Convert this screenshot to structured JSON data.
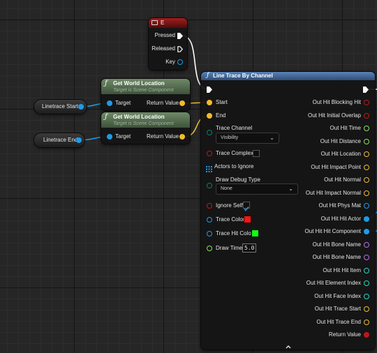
{
  "colors": {
    "exec": "#ffffff",
    "vector": "#f2bb2d",
    "object": "#1f9be6",
    "byte": "#0f7c6a",
    "bool": "#c01616",
    "array": "#1f9be6",
    "linear_color": "#1f9be6",
    "float": "#86e35a",
    "struct": "#1f9be6",
    "name": "#b76cf2",
    "int": "#21d7c7",
    "struct_hitresult": "#1f9be6",
    "input_event_header": "#7a1414",
    "function_header": "#4d6d4d",
    "linetrace_header": "#3c5e89",
    "trace_color": "#ff1414",
    "trace_hit_color": "#14ff14"
  },
  "event_node": {
    "title": "E",
    "icon": "keyboard-icon",
    "pins": [
      {
        "label": "Pressed",
        "type": "exec"
      },
      {
        "label": "Released",
        "type": "exec-hollow"
      },
      {
        "label": "Key",
        "type": "struct"
      }
    ]
  },
  "get_world_location_1": {
    "title": "Get World Location",
    "subtitle": "Target is Scene Component",
    "icon": "function-icon",
    "input_label": "Target",
    "output_label": "Return Value"
  },
  "get_world_location_2": {
    "title": "Get World Location",
    "subtitle": "Target is Scene Component",
    "icon": "function-icon",
    "input_label": "Target",
    "output_label": "Return Value"
  },
  "variables": {
    "linetrace_start": "Linetrace Start",
    "linetrace_end": "Linetrace End"
  },
  "line_trace": {
    "title": "Line Trace By Channel",
    "icon": "function-icon",
    "inputs": {
      "start": "Start",
      "end": "End",
      "trace_channel": "Trace Channel",
      "trace_channel_value": "Visibility",
      "trace_complex": "Trace Complex",
      "actors_to_ignore": "Actors to Ignore",
      "draw_debug_type": "Draw Debug Type",
      "draw_debug_type_value": "None",
      "ignore_self": "Ignore Self",
      "trace_color": "Trace Color",
      "trace_hit_color": "Trace Hit Color",
      "draw_time": "Draw Time",
      "draw_time_value": "5.0"
    },
    "trace_complex_checked": false,
    "ignore_self_checked": true,
    "outputs": [
      {
        "label": "Out Hit Blocking Hit",
        "type": "bool"
      },
      {
        "label": "Out Hit Initial Overlap",
        "type": "bool"
      },
      {
        "label": "Out Hit Time",
        "type": "float"
      },
      {
        "label": "Out Hit Distance",
        "type": "float"
      },
      {
        "label": "Out Hit Location",
        "type": "vector"
      },
      {
        "label": "Out Hit Impact Point",
        "type": "vector"
      },
      {
        "label": "Out Hit Normal",
        "type": "vector"
      },
      {
        "label": "Out Hit Impact Normal",
        "type": "vector"
      },
      {
        "label": "Out Hit Phys Mat",
        "type": "object"
      },
      {
        "label": "Out Hit Hit Actor",
        "type": "object"
      },
      {
        "label": "Out Hit Hit Component",
        "type": "object"
      },
      {
        "label": "Out Hit Bone Name",
        "type": "name"
      },
      {
        "label": "Out Hit Bone Name",
        "type": "name"
      },
      {
        "label": "Out Hit Hit Item",
        "type": "int"
      },
      {
        "label": "Out Hit Element Index",
        "type": "int"
      },
      {
        "label": "Out Hit Face Index",
        "type": "int"
      },
      {
        "label": "Out Hit Trace Start",
        "type": "vector"
      },
      {
        "label": "Out Hit Trace End",
        "type": "vector"
      },
      {
        "label": "Return Value",
        "type": "bool"
      }
    ],
    "collapse_icon": "chevron-up-icon"
  }
}
